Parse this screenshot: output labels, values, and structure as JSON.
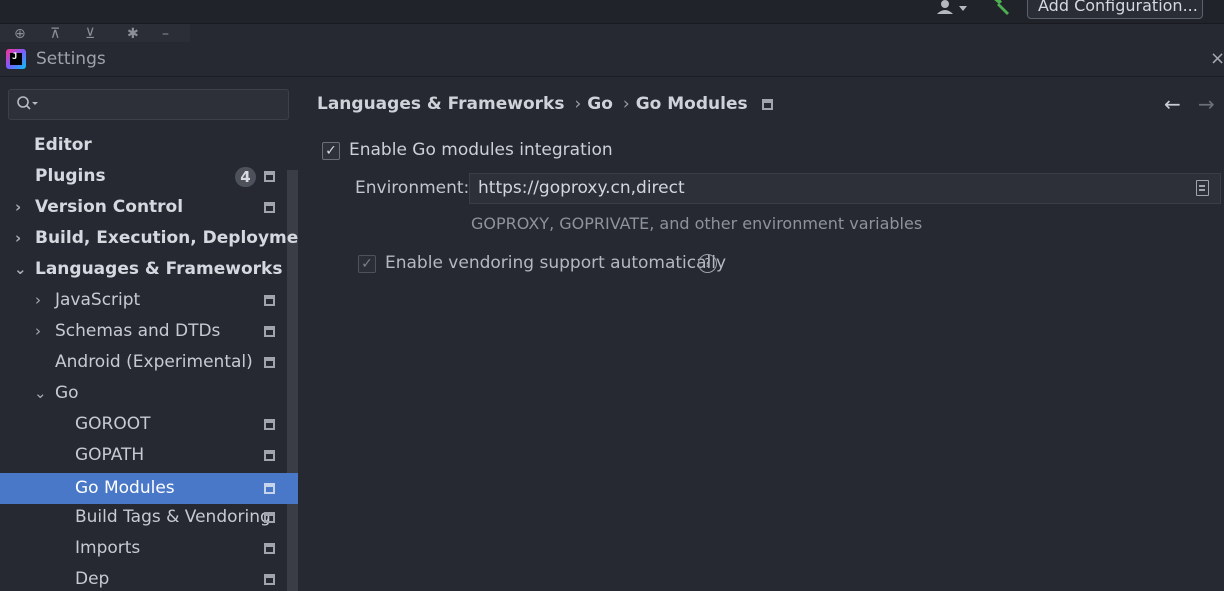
{
  "toolbar": {
    "add_configuration_label": "Add Configuration..."
  },
  "dialog": {
    "title": "Settings"
  },
  "search": {
    "placeholder": ""
  },
  "tree": {
    "items": [
      {
        "label": "Editor",
        "badge": ""
      },
      {
        "label": "Plugins",
        "badge": "4"
      },
      {
        "label": "Version Control"
      },
      {
        "label": "Build, Execution, Deployment"
      },
      {
        "label": "Languages & Frameworks"
      },
      {
        "label": "JavaScript"
      },
      {
        "label": "Schemas and DTDs"
      },
      {
        "label": "Android (Experimental)"
      },
      {
        "label": "Go"
      },
      {
        "label": "GOROOT"
      },
      {
        "label": "GOPATH"
      },
      {
        "label": "Go Modules"
      },
      {
        "label": "Build Tags & Vendoring"
      },
      {
        "label": "Imports"
      },
      {
        "label": "Dep"
      }
    ]
  },
  "breadcrumb": {
    "items": [
      "Languages & Frameworks",
      "Go",
      "Go Modules"
    ]
  },
  "go_modules": {
    "enable_integration_label": "Enable Go modules integration",
    "enable_integration_checked": true,
    "environment_label": "Environment:",
    "environment_value": "https://goproxy.cn,direct",
    "environment_hint": "GOPROXY, GOPRIVATE, and other environment variables",
    "vendoring_label": "Enable vendoring support automatically",
    "vendoring_checked": true,
    "vendoring_enabled": false
  },
  "colors": {
    "background": "#262932",
    "selection": "#4a78c8",
    "text": "#c6c9d0"
  }
}
